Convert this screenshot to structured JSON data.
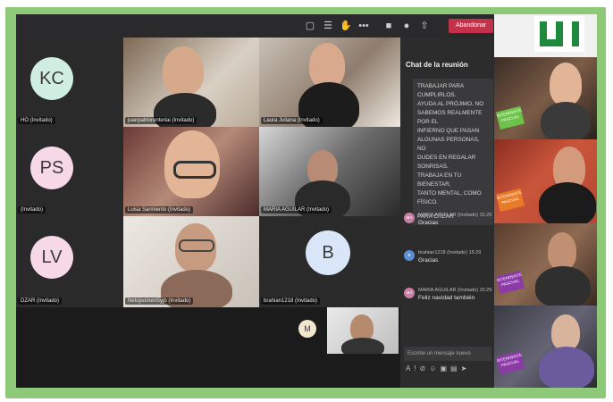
{
  "toolbar": {
    "leave_label": "Abandonar",
    "icons": [
      "chat-icon",
      "people-icon",
      "raise-hand-icon",
      "more-icon",
      "camera-icon",
      "mic-icon",
      "share-icon"
    ]
  },
  "participants_left": [
    {
      "initials": "KC",
      "name": "HO (Invitado)",
      "color": "#cfeee1"
    },
    {
      "initials": "PS",
      "name": "(Invitado)",
      "color": "#f6d8e6"
    },
    {
      "initials": "LV",
      "name": "DZAR (Invitado)",
      "color": "#f6d8e6"
    }
  ],
  "video_tiles": [
    {
      "name": "juanpablorenteriai (Invitado)"
    },
    {
      "name": "Laura Juliana (Invitado)"
    },
    {
      "name": "Luisa Sarmiento (Invitado)"
    },
    {
      "name": "MARIA AGUILAR (Invitado)"
    },
    {
      "name": "NetojsomenSyjb (Invitado)"
    }
  ],
  "avatar_tile": {
    "initials": "B",
    "name": "brahian1218 (Invitado)",
    "color": "#d9e6f7"
  },
  "small_avatar": {
    "initials": "M",
    "color": "#f3e6cf"
  },
  "chat": {
    "title": "Chat de la reunión",
    "bubble_lines": [
      "TRABAJAR PARA CUMPLIRLOS.",
      "AYUDA AL PRÓJIMO, NO",
      "SABEMOS REALMENTE POR EL",
      "INFIERNO QUE PASAN",
      "ALGUNAS PERSONAS, NO",
      "DUDES EN REGALAR SONRISAS.",
      "TRABAJA EN TU BIENESTAR,",
      "TANTO MENTAL, COMO FÍSICO.",
      "",
      "PARA CREAR"
    ],
    "messages": [
      {
        "avatar": "MA",
        "author": "MARIA AGUILAR (Invitado)",
        "time": "15:29",
        "text": "Gracias"
      },
      {
        "avatar": "B",
        "author": "brahian1218 (Invitado)",
        "time": "15:29",
        "text": "Gracias"
      },
      {
        "avatar": "MA",
        "author": "MARIA AGUILAR (Invitado)",
        "time": "15:29",
        "text": "Feliz navidad también"
      }
    ],
    "compose_placeholder": "Escribe un mensaje nuevo"
  },
  "right_panel": {
    "logo_text": "UN",
    "badge_text": "INTENDENTE\nPASCUAL",
    "badge_text2": "INTENDENTE\nPASCUAL",
    "badge_text3": "INTENDENTE\nPASCUAL",
    "badge_text4": "INTENDENTE\nPASCUAL"
  }
}
